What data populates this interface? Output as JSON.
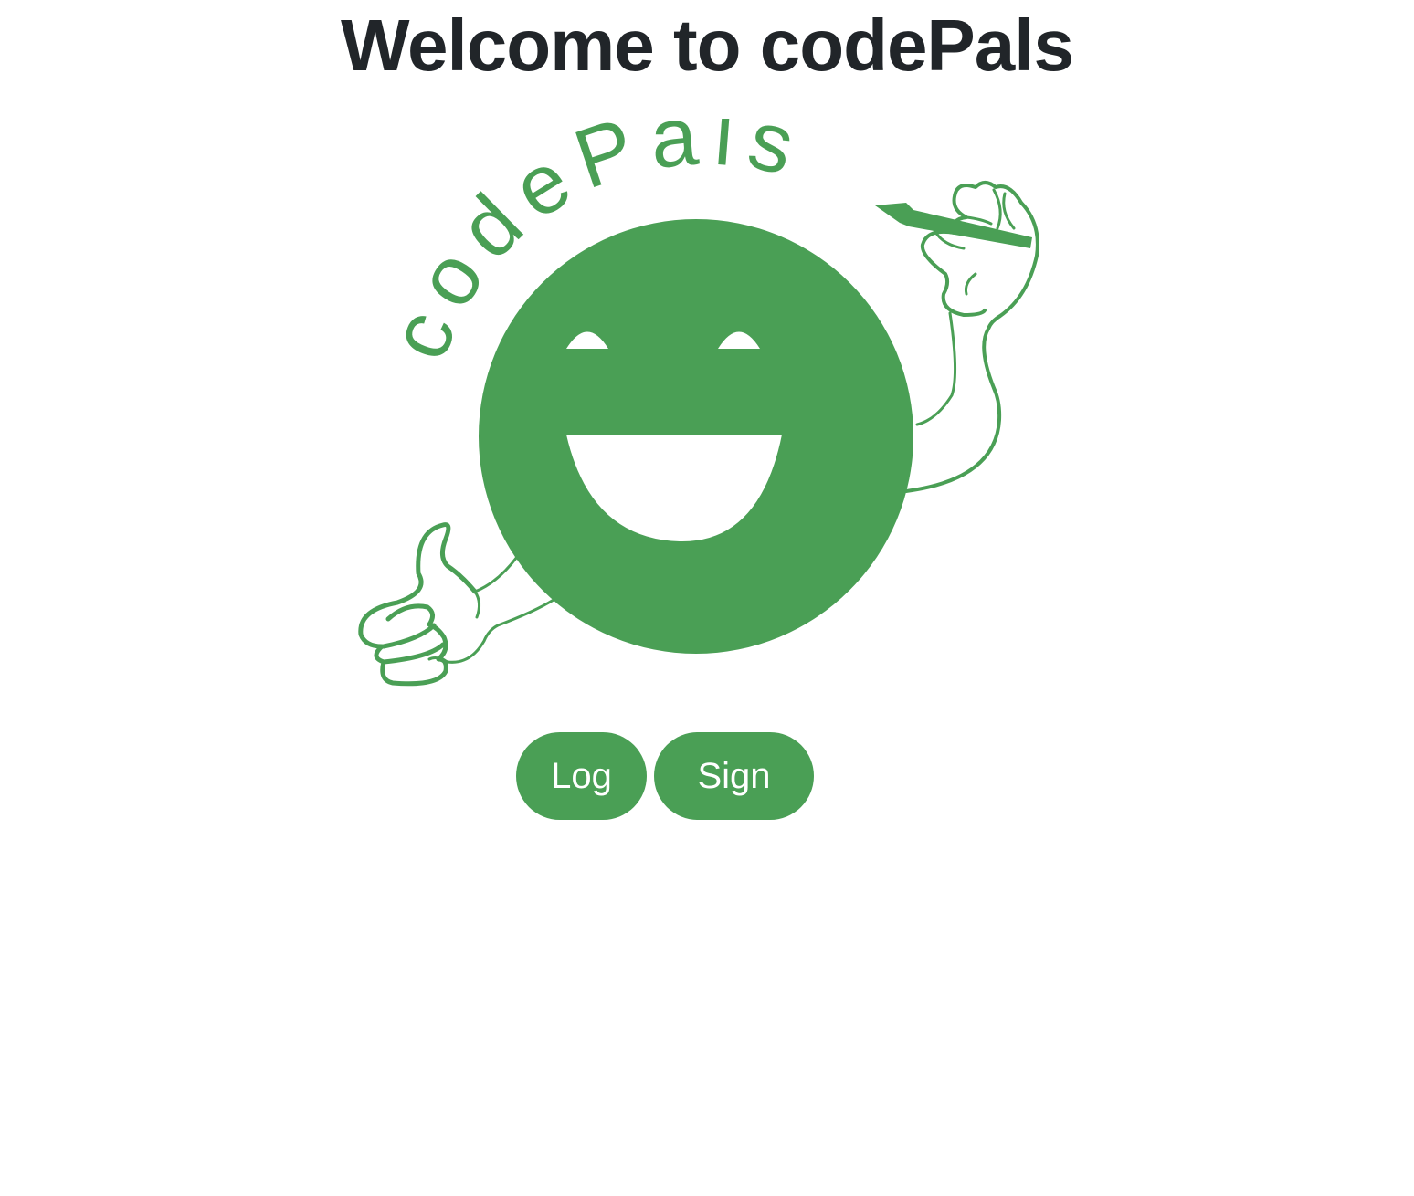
{
  "header": {
    "title": "Welcome to codePals"
  },
  "logo": {
    "wordmark": "codePals",
    "icon": "smiley-mascot-icon",
    "brand_color": "#4a9f55"
  },
  "actions": {
    "login_label": "Log In",
    "signup_label": "Sign Up"
  },
  "colors": {
    "heading": "#212529",
    "accent": "#4a9f55",
    "background": "#ffffff"
  }
}
